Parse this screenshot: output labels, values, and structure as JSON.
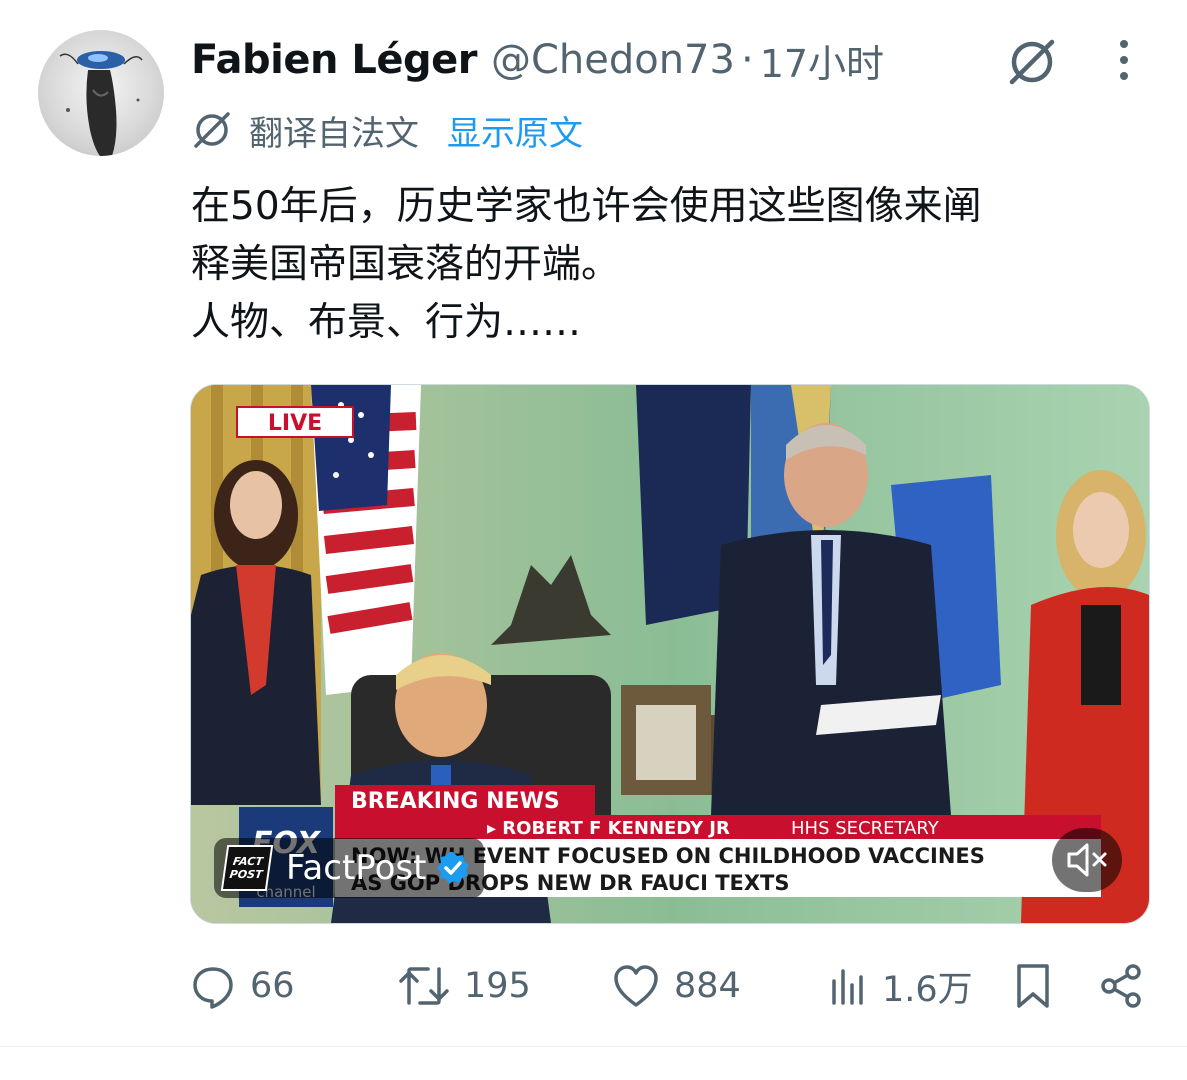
{
  "author": {
    "display_name": "Fabien Léger",
    "handle": "@Chedon73",
    "separator": "·",
    "time": "17小时"
  },
  "translation": {
    "label": "翻译自法文",
    "show_original": "显示原文"
  },
  "tweet_text": {
    "line1": "在50年后，历史学家也许会使用这些图像来阐",
    "line2": "释美国帝国衰落的开端。",
    "line3": "人物、布景、行为……"
  },
  "media": {
    "live_badge": "LIVE",
    "breaking_news": "BREAKING NEWS",
    "lower_third_name": "▸ ROBERT F KENNEDY JR",
    "lower_third_title": "HHS SECRETARY",
    "headline1": "NOW: WH EVENT FOCUSED ON CHILDHOOD VACCINES",
    "headline2": "AS GOP DROPS NEW DR FAUCI TEXTS",
    "network_logo": "FOX",
    "network_sub": "channel",
    "channel_logo_line1": "FACT",
    "channel_logo_line2": "POST",
    "channel_name": "FactPost"
  },
  "actions": {
    "replies": "66",
    "reposts": "195",
    "likes": "884",
    "views": "1.6万"
  },
  "colors": {
    "accent": "#1d9bf0",
    "secondary_text": "#536471",
    "primary_text": "#0f1419",
    "news_red": "#c8102e"
  },
  "icons": {
    "grok": "grok-icon",
    "more": "more-icon",
    "translate": "grok-translate-icon",
    "reply": "reply-icon",
    "repost": "repost-icon",
    "like": "like-icon",
    "views": "views-icon",
    "bookmark": "bookmark-icon",
    "share": "share-icon",
    "mute": "mute-icon",
    "verified": "verified-badge-icon"
  }
}
